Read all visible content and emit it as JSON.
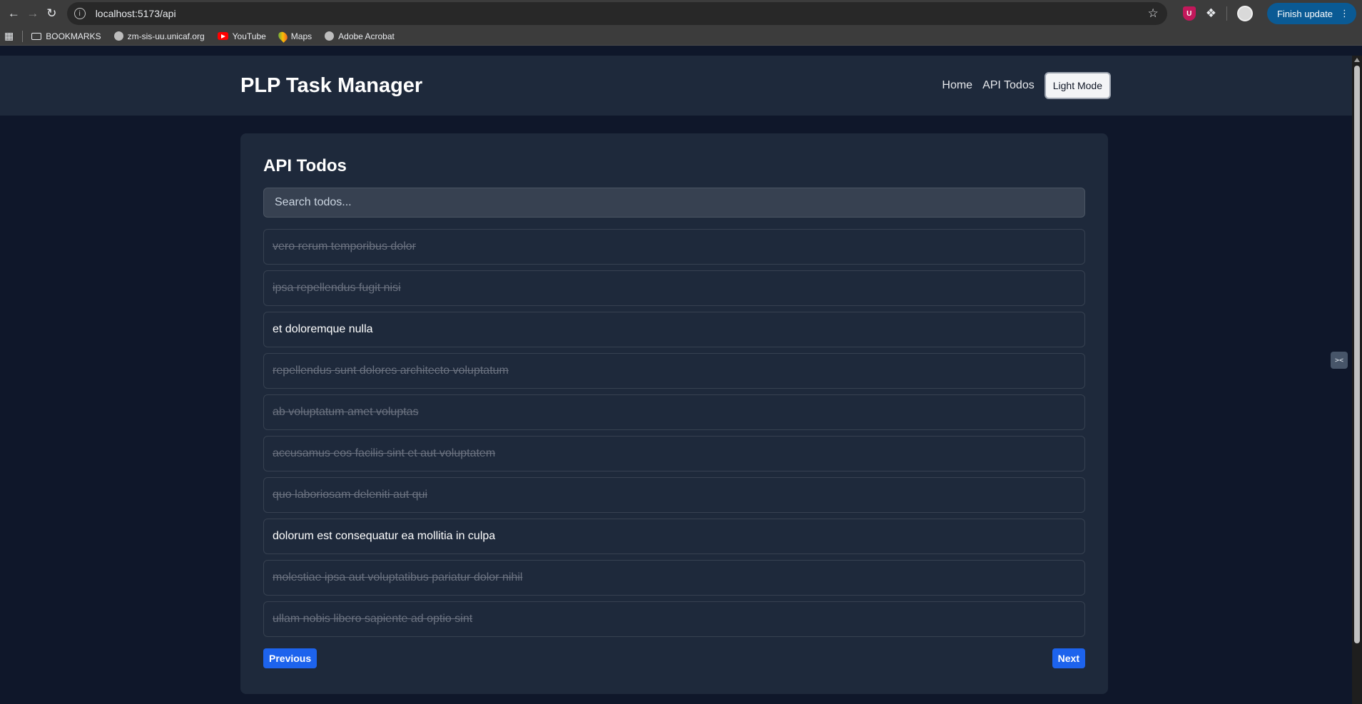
{
  "browser": {
    "url": "localhost:5173/api",
    "finish_update_label": "Finish update",
    "bookmarks": [
      {
        "label": "BOOKMARKS",
        "icon": "folder-icon"
      },
      {
        "label": "zm-sis-uu.unicaf.org",
        "icon": "globe-icon"
      },
      {
        "label": "YouTube",
        "icon": "youtube-icon"
      },
      {
        "label": "Maps",
        "icon": "maps-icon"
      },
      {
        "label": "Adobe Acrobat",
        "icon": "globe-icon"
      }
    ]
  },
  "header": {
    "title": "PLP Task Manager",
    "nav": {
      "home": "Home",
      "api_todos": "API Todos",
      "mode_toggle": "Light Mode"
    }
  },
  "main": {
    "title": "API Todos",
    "search_placeholder": "Search todos...",
    "todos": [
      {
        "title": "vero rerum temporibus dolor",
        "completed": true
      },
      {
        "title": "ipsa repellendus fugit nisi",
        "completed": true
      },
      {
        "title": "et doloremque nulla",
        "completed": false
      },
      {
        "title": "repellendus sunt dolores architecto voluptatum",
        "completed": true
      },
      {
        "title": "ab voluptatum amet voluptas",
        "completed": true
      },
      {
        "title": "accusamus eos facilis sint et aut voluptatem",
        "completed": true
      },
      {
        "title": "quo laboriosam deleniti aut qui",
        "completed": true
      },
      {
        "title": "dolorum est consequatur ea mollitia in culpa",
        "completed": false
      },
      {
        "title": "molestiae ipsa aut voluptatibus pariatur dolor nihil",
        "completed": true
      },
      {
        "title": "ullam nobis libero sapiente ad optio sint",
        "completed": true
      }
    ],
    "pagination": {
      "previous": "Previous",
      "next": "Next"
    }
  }
}
